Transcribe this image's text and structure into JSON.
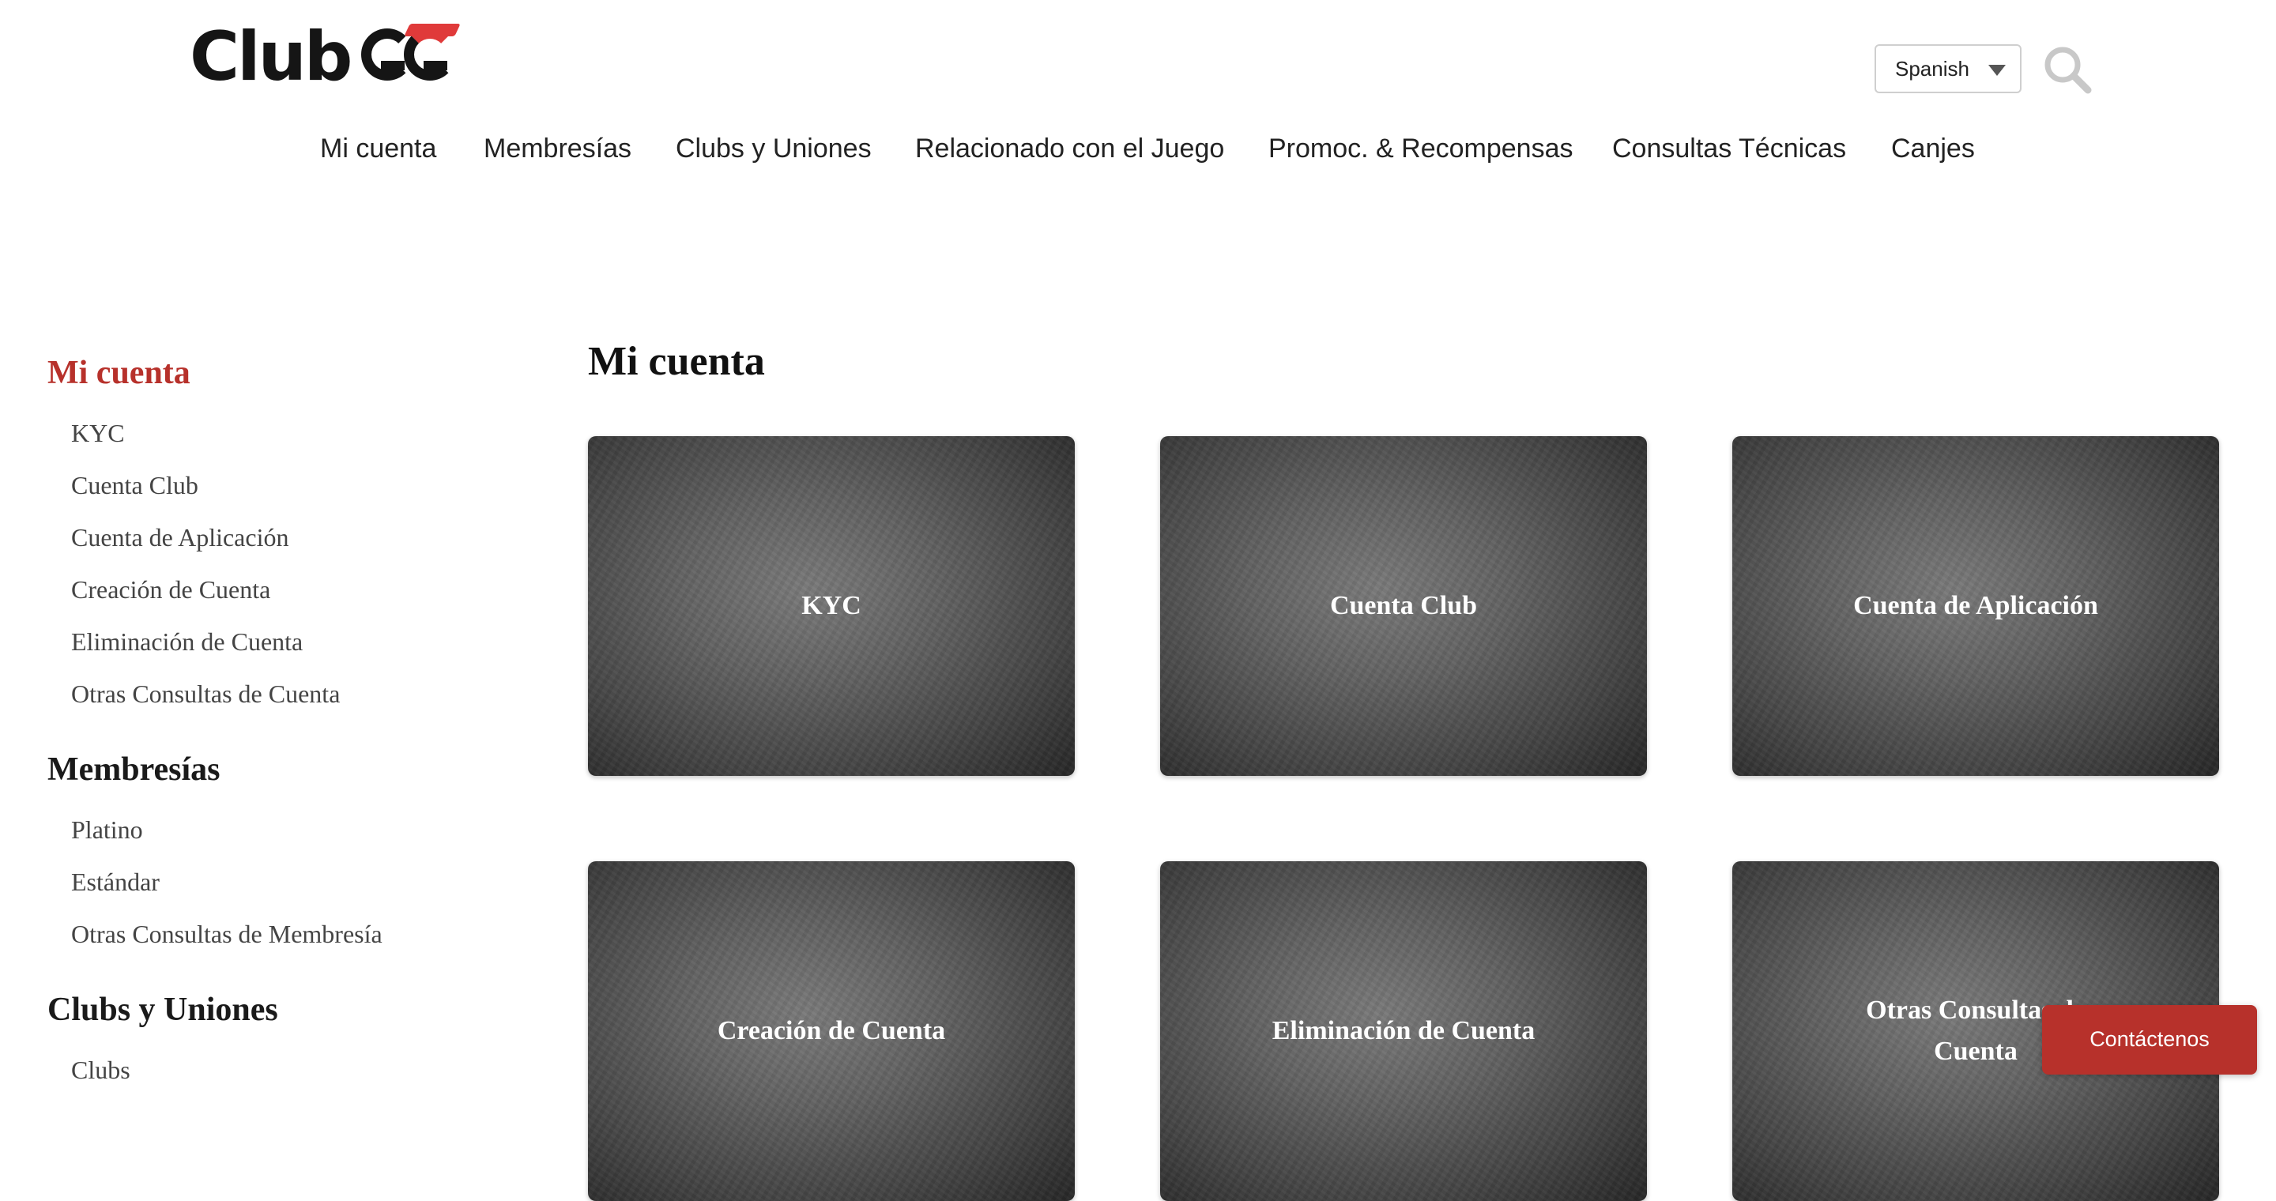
{
  "header": {
    "logo_text": "Club",
    "logo_mark": "GG",
    "language": "Spanish"
  },
  "nav": {
    "items": [
      {
        "label": "Mi cuenta"
      },
      {
        "label": "Membresías"
      },
      {
        "label": "Clubs y Uniones"
      },
      {
        "label": "Relacionado con el Juego"
      },
      {
        "label": "Promoc. & Recompensas"
      },
      {
        "label": "Consultas Técnicas"
      },
      {
        "label": "Canjes"
      }
    ]
  },
  "sidebar": {
    "sections": [
      {
        "title": "Mi cuenta",
        "items": [
          "KYC",
          "Cuenta Club",
          "Cuenta de Aplicación",
          "Creación de Cuenta",
          "Eliminación de Cuenta",
          "Otras Consultas de Cuenta"
        ]
      },
      {
        "title": "Membresías",
        "items": [
          "Platino",
          "Estándar",
          "Otras Consultas de Membresía"
        ]
      },
      {
        "title": "Clubs y Uniones",
        "items": [
          "Clubs"
        ]
      }
    ]
  },
  "main": {
    "title": "Mi cuenta",
    "cards": [
      "KYC",
      "Cuenta Club",
      "Cuenta de Aplicación",
      "Creación de Cuenta",
      "Eliminación de Cuenta",
      "Otras Consultas de Cuenta"
    ]
  },
  "contact": {
    "label": "Contáctenos"
  },
  "colors": {
    "accent": "#b7312b",
    "logo_red": "#e03a3a",
    "text": "#1d1d1d"
  }
}
